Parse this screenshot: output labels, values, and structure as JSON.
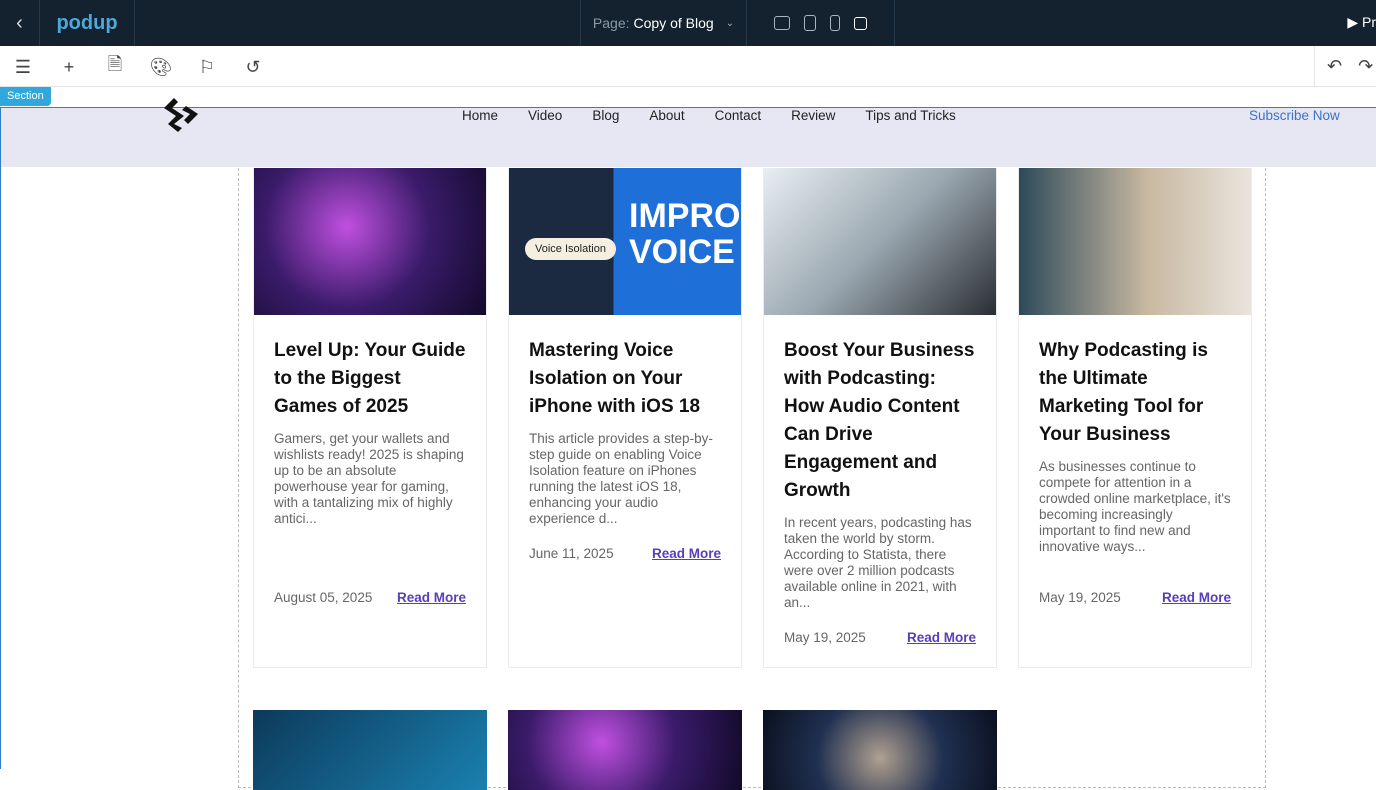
{
  "topbar": {
    "brand": "podup",
    "page_label": "Page:",
    "page_value": "Copy of Blog",
    "preview": "▶ Pr"
  },
  "section_tag": "Section",
  "nav": {
    "brand_mark": "ဏ",
    "items": [
      "Home",
      "Video",
      "Blog",
      "About",
      "Contact",
      "Review",
      "Tips and Tricks"
    ],
    "cta": "Subscribe Now"
  },
  "cards": [
    {
      "title": "Level Up: Your Guide to the Biggest Games of 2025",
      "excerpt": "Gamers, get your wallets and wishlists ready! 2025 is shaping up to be an absolute powerhouse year for gaming, with a tantalizing mix of highly antici...",
      "date": "August 05, 2025",
      "link": "Read More"
    },
    {
      "title": "Mastering Voice Isolation on Your iPhone with iOS 18",
      "excerpt": "This article provides a step-by-step guide on enabling Voice Isolation feature on iPhones running the latest iOS 18, enhancing your audio experience d...",
      "date": "June 11, 2025",
      "link": "Read More",
      "img_text": "IMPROVE VOICE",
      "img_badge": "Voice Isolation"
    },
    {
      "title": "Boost Your Business with Podcasting: How Audio Content Can Drive Engagement and Growth",
      "excerpt": "In recent years, podcasting has taken the world by storm. According to Statista, there were over 2 million podcasts available online in 2021, with an...",
      "date": "May 19, 2025",
      "link": "Read More"
    },
    {
      "title": "Why Podcasting is the Ultimate Marketing Tool for Your Business",
      "excerpt": "As businesses continue to compete for attention in a crowded online marketplace, it's becoming increasingly important to find new and innovative ways...",
      "date": "May 19, 2025",
      "link": "Read More"
    }
  ]
}
